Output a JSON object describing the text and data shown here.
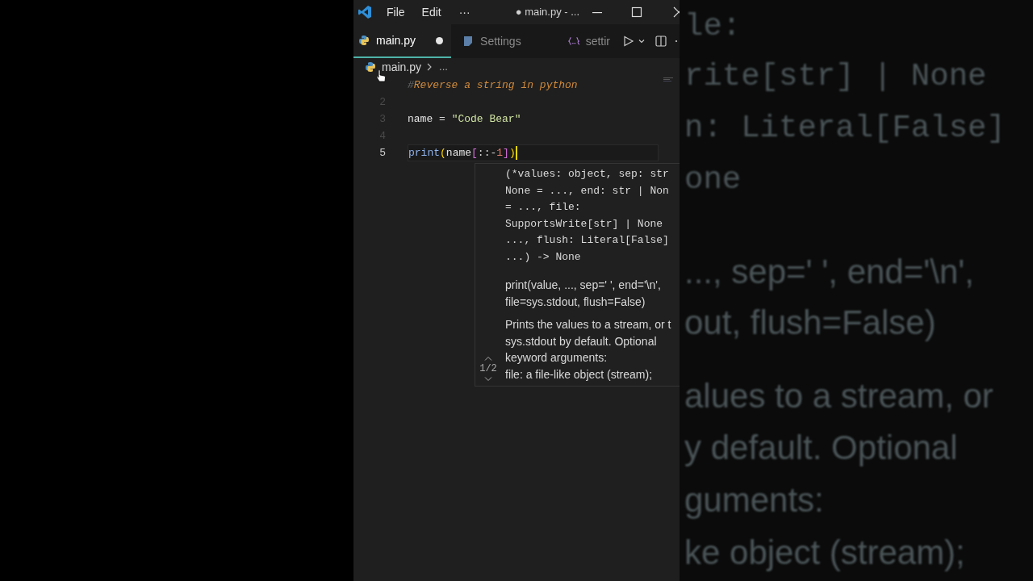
{
  "title_bar": {
    "menus": [
      "File",
      "Edit",
      "···"
    ],
    "title": "● main.py - ..."
  },
  "tabs": [
    {
      "label": "main.py",
      "kind": "python",
      "selected": true,
      "dirty": true
    },
    {
      "label": "Settings",
      "kind": "settings",
      "selected": false,
      "dirty": false
    },
    {
      "label": "settir",
      "kind": "json",
      "selected": false,
      "dirty": false
    }
  ],
  "breadcrumb": {
    "file": "main.py",
    "more": "..."
  },
  "editor": {
    "lines": [
      {
        "current": false,
        "tokens": [
          {
            "kind": "comment_mark",
            "text": "#"
          },
          {
            "kind": "comment",
            "text": "Reverse a string in python"
          }
        ]
      },
      {
        "number": "2",
        "current": false
      },
      {
        "number": "3",
        "current": false,
        "tokens": [
          {
            "kind": "variable",
            "text": "name"
          },
          {
            "kind": "operator",
            "text": " = "
          },
          {
            "kind": "string",
            "text": "\"Code Bear\""
          }
        ]
      },
      {
        "number": "4",
        "current": false
      },
      {
        "number": "5",
        "current": true,
        "tokens": [
          {
            "kind": "function",
            "text": "print"
          },
          {
            "kind": "bracket1",
            "text": "("
          },
          {
            "kind": "variable",
            "text": "name"
          },
          {
            "kind": "bracket2",
            "text": "["
          },
          {
            "kind": "operator",
            "text": "::-"
          },
          {
            "kind": "number",
            "text": "1"
          },
          {
            "kind": "bracket2",
            "text": "]"
          },
          {
            "kind": "bracket1",
            "text": ")"
          }
        ]
      }
    ]
  },
  "hover": {
    "signature": [
      "(*values: object, sep: str",
      "None = ..., end: str | Non",
      "= ..., file:",
      "SupportsWrite[str] | None",
      "..., flush: Literal[False]",
      "...) -> None"
    ],
    "doc_signature": [
      "print(value, ..., sep=' ', end='\\n',",
      "file=sys.stdout, flush=False)"
    ],
    "doc": [
      "Prints the values to a stream, or t",
      "sys.stdout by default. Optional",
      "keyword arguments:",
      "file: a file-like object (stream);"
    ],
    "pager": "1/2"
  },
  "background_echo": [
    {
      "kind": "mono",
      "text": "le:"
    },
    {
      "kind": "mono",
      "text": "rite[str] | None"
    },
    {
      "kind": "mono",
      "text": "n: Literal[False]"
    },
    {
      "kind": "mono",
      "text": "one"
    },
    {
      "kind": "sans",
      "text": "..., sep=' ', end='\\n',"
    },
    {
      "kind": "sans",
      "text": "out, flush=False)"
    },
    {
      "kind": "sans",
      "text": "alues to a stream, or"
    },
    {
      "kind": "sans",
      "text": "y default. Optional"
    },
    {
      "kind": "sans",
      "text": "guments:"
    },
    {
      "kind": "sans",
      "text": "ke object (stream);"
    }
  ]
}
